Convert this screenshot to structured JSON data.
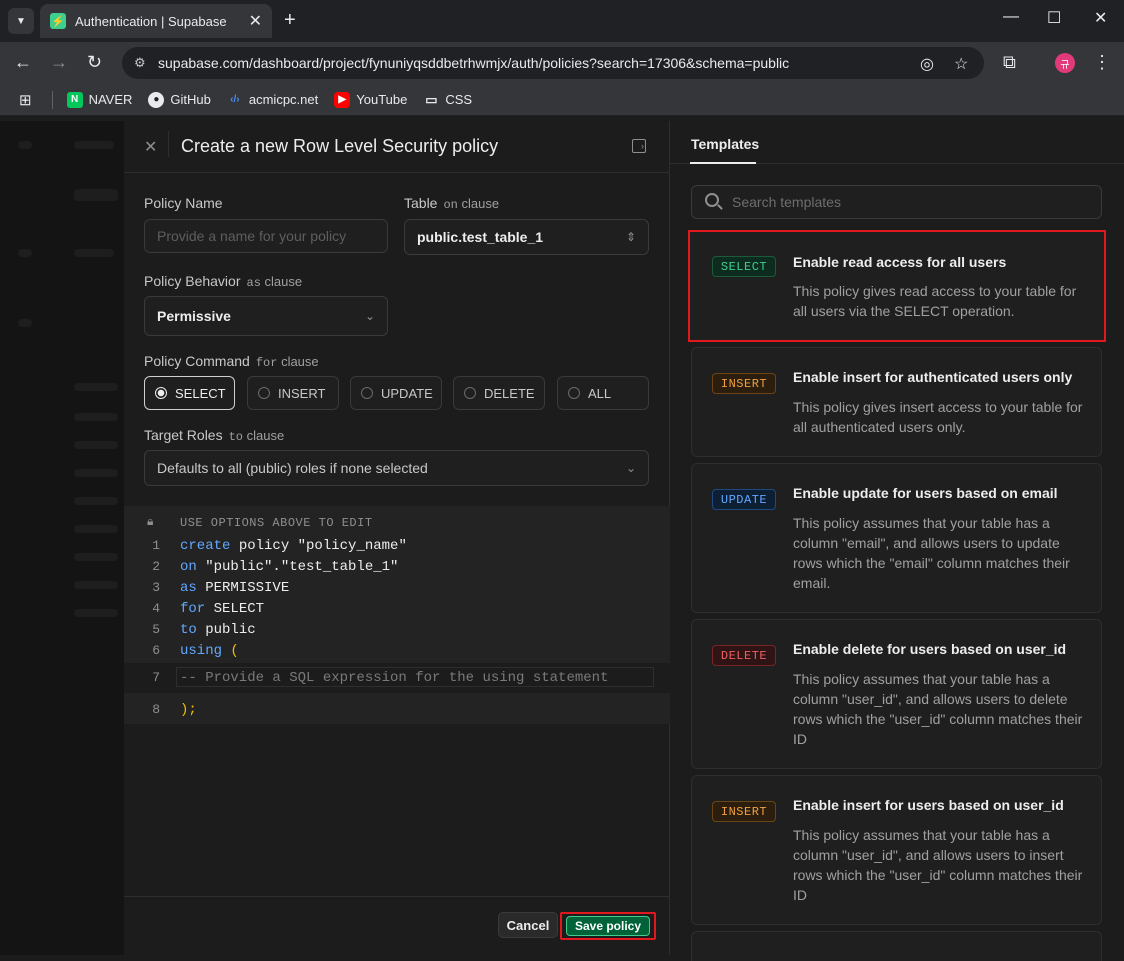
{
  "browser": {
    "tab_title": "Authentication | Supabase",
    "url": "supabase.com/dashboard/project/fynuniyqsddbetrhwmjx/auth/policies?search=17306&schema=public",
    "profile_initial": "규",
    "bookmarks": [
      {
        "label": "NAVER",
        "icon": "naver-icon"
      },
      {
        "label": "GitHub",
        "icon": "github-icon"
      },
      {
        "label": "acmicpc.net",
        "icon": "code-icon"
      },
      {
        "label": "YouTube",
        "icon": "youtube-icon"
      },
      {
        "label": "CSS",
        "icon": "folder-icon"
      }
    ]
  },
  "policy_form": {
    "title": "Create a new Row Level Security policy",
    "policy_name": {
      "label": "Policy Name",
      "placeholder": "Provide a name for your policy",
      "value": ""
    },
    "table": {
      "label": "Table",
      "sub_keyword": "on",
      "sub_suffix": "clause",
      "value": "public.test_table_1"
    },
    "behavior": {
      "label": "Policy Behavior",
      "sub_keyword": "as",
      "sub_suffix": "clause",
      "value": "Permissive"
    },
    "command": {
      "label": "Policy Command",
      "sub_keyword": "for",
      "sub_suffix": "clause",
      "options": [
        "SELECT",
        "INSERT",
        "UPDATE",
        "DELETE",
        "ALL"
      ],
      "selected": "SELECT"
    },
    "roles": {
      "label": "Target Roles",
      "sub_keyword": "to",
      "sub_suffix": "clause",
      "value": "Defaults to all (public) roles if none selected"
    },
    "editor": {
      "locked_note": "USE OPTIONS ABOVE TO EDIT",
      "lines": [
        {
          "n": "1",
          "kw": "create",
          "rest": " policy \"policy_name\""
        },
        {
          "n": "2",
          "kw": "on",
          "rest": " \"public\".\"test_table_1\""
        },
        {
          "n": "3",
          "kw": "as",
          "rest": " PERMISSIVE"
        },
        {
          "n": "4",
          "kw": "for",
          "rest": " SELECT"
        },
        {
          "n": "5",
          "kw": "to",
          "rest": " public"
        },
        {
          "n": "6",
          "kw": "using",
          "rest": " ("
        }
      ],
      "line7": {
        "n": "7",
        "comment": "-- Provide a SQL expression for the using statement"
      },
      "line8": {
        "n": "8",
        "text": ");"
      }
    },
    "cancel_label": "Cancel",
    "save_label": "Save policy"
  },
  "templates": {
    "tab_label": "Templates",
    "search_placeholder": "Search templates",
    "items": [
      {
        "badge": "SELECT",
        "title": "Enable read access for all users",
        "desc": "This policy gives read access to your table for all users via the SELECT operation."
      },
      {
        "badge": "INSERT",
        "title": "Enable insert for authenticated users only",
        "desc": "This policy gives insert access to your table for all authenticated users only."
      },
      {
        "badge": "UPDATE",
        "title": "Enable update for users based on email",
        "desc": "This policy assumes that your table has a column \"email\", and allows users to update rows which the \"email\" column matches their email."
      },
      {
        "badge": "DELETE",
        "title": "Enable delete for users based on user_id",
        "desc": "This policy assumes that your table has a column \"user_id\", and allows users to delete rows which the \"user_id\" column matches their ID"
      },
      {
        "badge": "INSERT",
        "title": "Enable insert for users based on user_id",
        "desc": "This policy assumes that your table has a column \"user_id\", and allows users to insert rows which the \"user_id\" column matches their ID"
      }
    ]
  }
}
